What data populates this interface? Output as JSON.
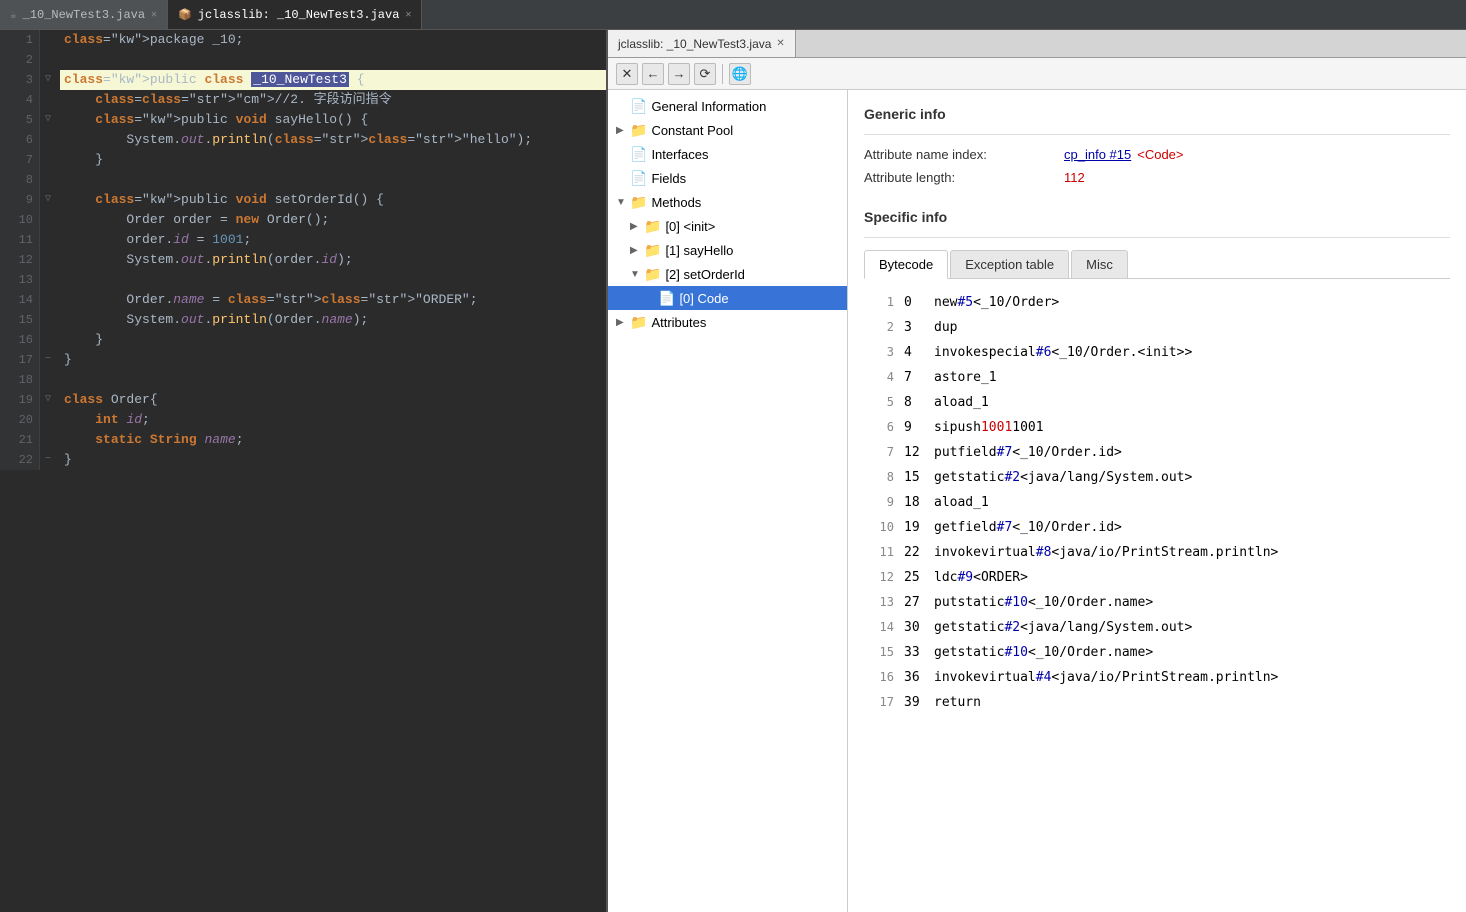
{
  "tabs": [
    {
      "id": "editor",
      "label": "_10_NewTest3.java",
      "active": false,
      "icon": "java"
    },
    {
      "id": "jclasslib",
      "label": "jclasslib:   _10_NewTest3.java",
      "active": true,
      "icon": "jc"
    }
  ],
  "editor": {
    "lines": [
      {
        "num": 1,
        "fold": "",
        "code": "package _10;",
        "style": ""
      },
      {
        "num": 2,
        "fold": "",
        "code": "",
        "style": ""
      },
      {
        "num": 3,
        "fold": "▽",
        "code": "public class _10_NewTest3 {",
        "style": "highlight"
      },
      {
        "num": 4,
        "fold": "",
        "code": "    //2. 字段访问指令",
        "style": ""
      },
      {
        "num": 5,
        "fold": "▽",
        "code": "    public void sayHello() {",
        "style": ""
      },
      {
        "num": 6,
        "fold": "",
        "code": "        System.out.println(\"hello\");",
        "style": ""
      },
      {
        "num": 7,
        "fold": "",
        "code": "    }",
        "style": ""
      },
      {
        "num": 8,
        "fold": "",
        "code": "",
        "style": ""
      },
      {
        "num": 9,
        "fold": "▽",
        "code": "    public void setOrderId() {",
        "style": ""
      },
      {
        "num": 10,
        "fold": "",
        "code": "        Order order = new Order();",
        "style": ""
      },
      {
        "num": 11,
        "fold": "",
        "code": "        order.id = 1001;",
        "style": ""
      },
      {
        "num": 12,
        "fold": "",
        "code": "        System.out.println(order.id);",
        "style": ""
      },
      {
        "num": 13,
        "fold": "",
        "code": "",
        "style": ""
      },
      {
        "num": 14,
        "fold": "",
        "code": "        Order.name = \"ORDER\";",
        "style": ""
      },
      {
        "num": 15,
        "fold": "",
        "code": "        System.out.println(Order.name);",
        "style": ""
      },
      {
        "num": 16,
        "fold": "",
        "code": "    }",
        "style": ""
      },
      {
        "num": 17,
        "fold": "−",
        "code": "}",
        "style": ""
      },
      {
        "num": 18,
        "fold": "",
        "code": "",
        "style": ""
      },
      {
        "num": 19,
        "fold": "▽",
        "code": "class Order{",
        "style": ""
      },
      {
        "num": 20,
        "fold": "",
        "code": "    int id;",
        "style": ""
      },
      {
        "num": 21,
        "fold": "",
        "code": "    static String name;",
        "style": ""
      },
      {
        "num": 22,
        "fold": "−",
        "code": "}",
        "style": ""
      }
    ]
  },
  "jclasslib": {
    "toolbar": {
      "close": "✕",
      "back": "←",
      "forward": "→",
      "refresh": "⟳",
      "browser": "🌐"
    },
    "tree": {
      "items": [
        {
          "id": "general-info",
          "label": "General Information",
          "level": 0,
          "expanded": false,
          "selected": false,
          "icon": "📄"
        },
        {
          "id": "constant-pool",
          "label": "Constant Pool",
          "level": 0,
          "expanded": false,
          "selected": false,
          "icon": "📁",
          "arrow": "▶"
        },
        {
          "id": "interfaces",
          "label": "Interfaces",
          "level": 0,
          "expanded": false,
          "selected": false,
          "icon": "📄"
        },
        {
          "id": "fields",
          "label": "Fields",
          "level": 0,
          "expanded": false,
          "selected": false,
          "icon": "📄"
        },
        {
          "id": "methods",
          "label": "Methods",
          "level": 0,
          "expanded": true,
          "selected": false,
          "icon": "📁",
          "arrow": "▼"
        },
        {
          "id": "method-init",
          "label": "[0] <init>",
          "level": 1,
          "expanded": false,
          "selected": false,
          "icon": "📁",
          "arrow": "▶"
        },
        {
          "id": "method-sayHello",
          "label": "[1] sayHello",
          "level": 1,
          "expanded": false,
          "selected": false,
          "icon": "📁",
          "arrow": "▶"
        },
        {
          "id": "method-setOrderId",
          "label": "[2] setOrderId",
          "level": 1,
          "expanded": true,
          "selected": false,
          "icon": "📁",
          "arrow": "▼"
        },
        {
          "id": "code-node",
          "label": "[0] Code",
          "level": 2,
          "expanded": false,
          "selected": true,
          "icon": "📄"
        },
        {
          "id": "attributes",
          "label": "Attributes",
          "level": 0,
          "expanded": false,
          "selected": false,
          "icon": "📁",
          "arrow": "▶"
        }
      ]
    },
    "detail": {
      "generic_info_title": "Generic info",
      "attribute_name_label": "Attribute name index:",
      "attribute_name_link": "cp_info #15",
      "attribute_name_value": "<Code>",
      "attribute_length_label": "Attribute length:",
      "attribute_length_value": "112",
      "specific_info_title": "Specific info",
      "tabs": [
        "Bytecode",
        "Exception table",
        "Misc"
      ],
      "active_tab": "Bytecode",
      "bytecode": [
        {
          "line": 1,
          "offset": "0",
          "instr": "new",
          "ref": "#5",
          "comment": "<_10/Order>"
        },
        {
          "line": 2,
          "offset": "3",
          "instr": "dup",
          "ref": "",
          "comment": ""
        },
        {
          "line": 3,
          "offset": "4",
          "instr": "invokespecial",
          "ref": "#6",
          "comment": "<_10/Order.<init>>"
        },
        {
          "line": 4,
          "offset": "7",
          "instr": "astore_1",
          "ref": "",
          "comment": ""
        },
        {
          "line": 5,
          "offset": "8",
          "instr": "aload_1",
          "ref": "",
          "comment": ""
        },
        {
          "line": 6,
          "offset": "9",
          "instr": "sipush",
          "ref": "",
          "comment": "1001",
          "numval": "1001"
        },
        {
          "line": 7,
          "offset": "12",
          "instr": "putfield",
          "ref": "#7",
          "comment": "<_10/Order.id>"
        },
        {
          "line": 8,
          "offset": "15",
          "instr": "getstatic",
          "ref": "#2",
          "comment": "<java/lang/System.out>"
        },
        {
          "line": 9,
          "offset": "18",
          "instr": "aload_1",
          "ref": "",
          "comment": ""
        },
        {
          "line": 10,
          "offset": "19",
          "instr": "getfield",
          "ref": "#7",
          "comment": "<_10/Order.id>"
        },
        {
          "line": 11,
          "offset": "22",
          "instr": "invokevirtual",
          "ref": "#8",
          "comment": "<java/io/PrintStream.println>"
        },
        {
          "line": 12,
          "offset": "25",
          "instr": "ldc",
          "ref": "#9",
          "comment": "<ORDER>"
        },
        {
          "line": 13,
          "offset": "27",
          "instr": "putstatic",
          "ref": "#10",
          "comment": "<_10/Order.name>"
        },
        {
          "line": 14,
          "offset": "30",
          "instr": "getstatic",
          "ref": "#2",
          "comment": "<java/lang/System.out>"
        },
        {
          "line": 15,
          "offset": "33",
          "instr": "getstatic",
          "ref": "#10",
          "comment": "<_10/Order.name>"
        },
        {
          "line": 16,
          "offset": "36",
          "instr": "invokevirtual",
          "ref": "#4",
          "comment": "<java/io/PrintStream.println>"
        },
        {
          "line": 17,
          "offset": "39",
          "instr": "return",
          "ref": "",
          "comment": ""
        }
      ]
    }
  }
}
